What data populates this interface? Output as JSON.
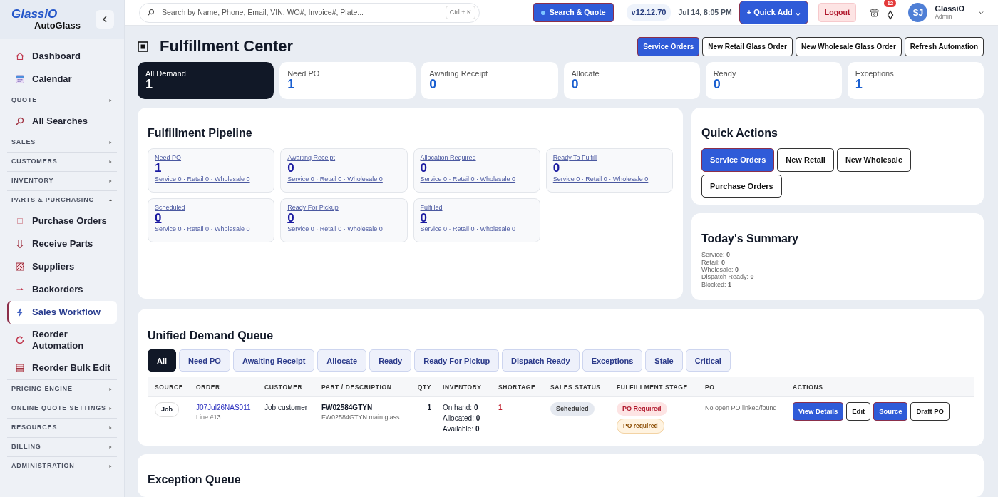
{
  "sidebar": {
    "brand": "GlassiO",
    "brand_sub": "AutoGlass",
    "items": [
      {
        "kind": "link",
        "label": "Dashboard",
        "selected": false
      },
      {
        "kind": "link",
        "label": "Calendar",
        "selected": false
      },
      {
        "kind": "section",
        "label": "QUOTE",
        "expanded": false
      },
      {
        "kind": "link",
        "label": "All Searches",
        "selected": false
      },
      {
        "kind": "section",
        "label": "SALES",
        "expanded": false
      },
      {
        "kind": "section",
        "label": "CUSTOMERS",
        "expanded": false
      },
      {
        "kind": "section",
        "label": "INVENTORY",
        "expanded": false
      },
      {
        "kind": "section",
        "label": "PARTS & PURCHASING",
        "expanded": true
      },
      {
        "kind": "link",
        "label": "Purchase Orders",
        "selected": false
      },
      {
        "kind": "link",
        "label": "Receive Parts",
        "selected": false
      },
      {
        "kind": "link",
        "label": "Suppliers",
        "selected": false
      },
      {
        "kind": "link",
        "label": "Backorders",
        "selected": false
      },
      {
        "kind": "link",
        "label": "Sales Workflow",
        "selected": true
      },
      {
        "kind": "link",
        "label": "Reorder Automation",
        "selected": false
      },
      {
        "kind": "link",
        "label": "Reorder Bulk Edit",
        "selected": false
      },
      {
        "kind": "section",
        "label": "PRICING ENGINE",
        "expanded": false
      },
      {
        "kind": "section",
        "label": "ONLINE QUOTE SETTINGS",
        "expanded": false
      },
      {
        "kind": "section",
        "label": "RESOURCES",
        "expanded": false
      },
      {
        "kind": "section",
        "label": "BILLING",
        "expanded": false
      },
      {
        "kind": "section",
        "label": "ADMINISTRATION",
        "expanded": false
      }
    ]
  },
  "topbar": {
    "search": {
      "placeholder": "Search by Name, Phone, Email, VIN, WO#, Invoice#, Plate...",
      "shortcut": "Ctrl + K"
    },
    "search_quote_button": "Search & Quote",
    "version": "v12.12.70",
    "datetime": "Jul 14, 8:05 PM",
    "quick_add_button": "+ Quick Add",
    "logout_button": "Logout",
    "notification_count": "12",
    "user": {
      "initials": "SJ",
      "name": "GlassiO",
      "role": "Admin"
    }
  },
  "page": {
    "title": "Fulfillment Center",
    "header_buttons": [
      {
        "label": "Service Orders",
        "kind": "primary"
      },
      {
        "label": "New Retail Glass Order",
        "kind": "outline"
      },
      {
        "label": "New Wholesale Glass Order",
        "kind": "outline"
      },
      {
        "label": "Refresh Automation",
        "kind": "outline"
      }
    ],
    "stats": [
      {
        "label": "All Demand",
        "value": "1",
        "selected": true
      },
      {
        "label": "Need PO",
        "value": "1",
        "selected": false
      },
      {
        "label": "Awaiting Receipt",
        "value": "0",
        "selected": false
      },
      {
        "label": "Allocate",
        "value": "0",
        "selected": false
      },
      {
        "label": "Ready",
        "value": "0",
        "selected": false
      },
      {
        "label": "Exceptions",
        "value": "1",
        "selected": false
      }
    ],
    "pipeline": {
      "title": "Fulfillment Pipeline",
      "stages": [
        {
          "label": "Need PO",
          "count": "1",
          "breakdown": "Service 0 · Retail 0 · Wholesale 0"
        },
        {
          "label": "Awaiting Receipt",
          "count": "0",
          "breakdown": "Service 0 · Retail 0 · Wholesale 0"
        },
        {
          "label": "Allocation Required",
          "count": "0",
          "breakdown": "Service 0 · Retail 0 · Wholesale 0"
        },
        {
          "label": "Ready To Fulfill",
          "count": "0",
          "breakdown": "Service 0 · Retail 0 · Wholesale 0"
        },
        {
          "label": "Scheduled",
          "count": "0",
          "breakdown": "Service 0 · Retail 0 · Wholesale 0"
        },
        {
          "label": "Ready For Pickup",
          "count": "0",
          "breakdown": "Service 0 · Retail 0 · Wholesale 0"
        },
        {
          "label": "Fulfilled",
          "count": "0",
          "breakdown": "Service 0 · Retail 0 · Wholesale 0"
        }
      ]
    },
    "quick_actions": {
      "title": "Quick Actions",
      "buttons": [
        {
          "label": "Service Orders",
          "kind": "primary"
        },
        {
          "label": "New Retail",
          "kind": "outline"
        },
        {
          "label": "New Wholesale",
          "kind": "outline"
        },
        {
          "label": "Purchase Orders",
          "kind": "outline"
        }
      ]
    },
    "summary": {
      "title": "Today's Summary",
      "lines": [
        "Service: **0**",
        "Retail: **0**",
        "Wholesale: **0**",
        "Dispatch Ready: **0**",
        "Blocked: **1**"
      ]
    },
    "queue": {
      "title": "Unified Demand Queue",
      "filters": [
        {
          "label": "All",
          "selected": true
        },
        {
          "label": "Need PO",
          "selected": false
        },
        {
          "label": "Awaiting Receipt",
          "selected": false
        },
        {
          "label": "Allocate",
          "selected": false
        },
        {
          "label": "Ready",
          "selected": false
        },
        {
          "label": "Ready For Pickup",
          "selected": false
        },
        {
          "label": "Dispatch Ready",
          "selected": false
        },
        {
          "label": "Exceptions",
          "selected": false
        },
        {
          "label": "Stale",
          "selected": false
        },
        {
          "label": "Critical",
          "selected": false
        }
      ],
      "columns": [
        "SOURCE",
        "ORDER",
        "CUSTOMER",
        "PART / DESCRIPTION",
        "QTY",
        "INVENTORY",
        "SHORTAGE",
        "SALES STATUS",
        "FULFILLMENT STAGE",
        "PO",
        "ACTIONS"
      ],
      "rows": [
        {
          "source": "Job",
          "order": "J07Jul26NAS011",
          "order_line": "Line #13",
          "customer": "Job customer",
          "part": "FW02584GTYN",
          "part_description": "FW02584GTYN main glass",
          "qty": "1",
          "inventory": [
            "On hand: **0**",
            "Allocated: **0**",
            "Available: **0**"
          ],
          "shortage": "1",
          "sales_status": "Scheduled",
          "fulfillment_stage": [
            {
              "label": "PO Required",
              "kind": "danger"
            },
            {
              "label": "PO required",
              "kind": "warning"
            }
          ],
          "po": "No open PO linked/found",
          "actions": [
            {
              "label": "View Details",
              "kind": "primary"
            },
            {
              "label": "Edit",
              "kind": "outline"
            },
            {
              "label": "Source",
              "kind": "primary"
            },
            {
              "label": "Draft PO",
              "kind": "outline"
            }
          ]
        }
      ]
    },
    "exception_queue": {
      "title": "Exception Queue"
    }
  }
}
